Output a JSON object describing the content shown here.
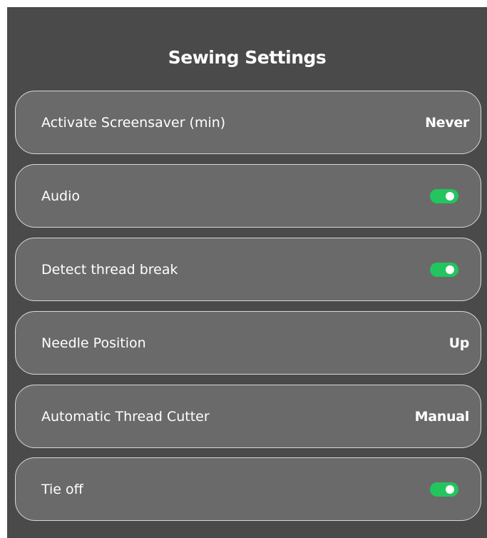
{
  "header": {
    "title": "Sewing Settings"
  },
  "settings": [
    {
      "label": "Activate Screensaver (min)",
      "type": "value",
      "value": "Never"
    },
    {
      "label": "Audio",
      "type": "toggle",
      "on": true
    },
    {
      "label": "Detect thread break",
      "type": "toggle",
      "on": true
    },
    {
      "label": "Needle Position",
      "type": "value",
      "value": "Up"
    },
    {
      "label": "Automatic Thread Cutter",
      "type": "value",
      "value": "Manual"
    },
    {
      "label": "Tie off",
      "type": "toggle",
      "on": true
    }
  ],
  "colors": {
    "background": "#4a4a4a",
    "row": "#6a6a6a",
    "row_border": "#d8d8d8",
    "toggle_on": "#22c55e"
  }
}
